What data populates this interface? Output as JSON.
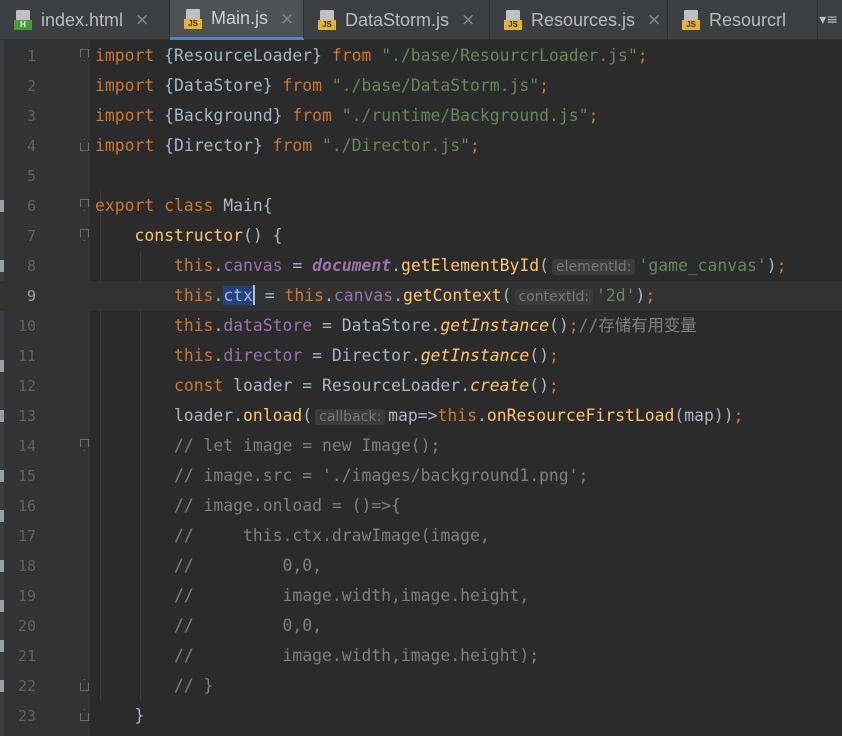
{
  "tabs": [
    {
      "label": "index.html",
      "type": "html",
      "active": false,
      "close": "×"
    },
    {
      "label": "Main.js",
      "type": "js",
      "active": true,
      "close": "×"
    },
    {
      "label": "DataStorm.js",
      "type": "js",
      "active": false,
      "close": "×"
    },
    {
      "label": "Resources.js",
      "type": "js",
      "active": false,
      "close": "×"
    },
    {
      "label": "Resourcrl",
      "type": "js",
      "active": false,
      "close": ""
    }
  ],
  "tab_overflow": "▾≡",
  "file_badges": {
    "html": "H",
    "js": "JS"
  },
  "caret_line": 9,
  "colors": {
    "background": "#2b2b2b",
    "gutter": "#313335",
    "keyword": "#cc7832",
    "string": "#6a8759",
    "property": "#9876aa",
    "method": "#ffc66d",
    "comment": "#808080",
    "default": "#a9b7c6",
    "selection": "#214283",
    "active_tab_underline": "#4a88c7"
  },
  "lines": [
    {
      "n": "1",
      "fold": "start",
      "tokens": [
        [
          "keyword",
          "import"
        ],
        [
          "plain",
          " {ResourceLoader} "
        ],
        [
          "keyword",
          "from"
        ],
        [
          "plain",
          " "
        ],
        [
          "string",
          "\"./base/ResourcrLoader.js\""
        ],
        [
          "keyword",
          ";"
        ]
      ]
    },
    {
      "n": "2",
      "tokens": [
        [
          "keyword",
          "import"
        ],
        [
          "plain",
          " {DataStore} "
        ],
        [
          "keyword",
          "from"
        ],
        [
          "plain",
          " "
        ],
        [
          "string",
          "\"./base/DataStorm.js\""
        ],
        [
          "keyword",
          ";"
        ]
      ]
    },
    {
      "n": "3",
      "tokens": [
        [
          "keyword",
          "import"
        ],
        [
          "plain",
          " {Background} "
        ],
        [
          "keyword",
          "from"
        ],
        [
          "plain",
          " "
        ],
        [
          "string",
          "\"./runtime/Background.js\""
        ],
        [
          "keyword",
          ";"
        ]
      ]
    },
    {
      "n": "4",
      "fold": "end",
      "tokens": [
        [
          "keyword",
          "import"
        ],
        [
          "plain",
          " {Director} "
        ],
        [
          "keyword",
          "from"
        ],
        [
          "plain",
          " "
        ],
        [
          "string",
          "\"./Director.js\""
        ],
        [
          "keyword",
          ";"
        ]
      ]
    },
    {
      "n": "5",
      "tokens": []
    },
    {
      "n": "6",
      "fold": "start",
      "tokens": [
        [
          "keyword",
          "export class "
        ],
        [
          "plain",
          "Main{"
        ]
      ]
    },
    {
      "n": "7",
      "fold": "start",
      "tokens": [
        [
          "plain",
          "    "
        ],
        [
          "method",
          "constructor"
        ],
        [
          "plain",
          "() {"
        ]
      ]
    },
    {
      "n": "8",
      "tokens": [
        [
          "plain",
          "        "
        ],
        [
          "this",
          "this"
        ],
        [
          "plain",
          "."
        ],
        [
          "prop",
          "canvas"
        ],
        [
          "plain",
          " = "
        ],
        [
          "global",
          "document"
        ],
        [
          "plain",
          "."
        ],
        [
          "method",
          "getElementById"
        ],
        [
          "plain",
          "("
        ],
        [
          "hint",
          "elementId:"
        ],
        [
          "string",
          "'game_canvas'"
        ],
        [
          "plain",
          ")"
        ],
        [
          "keyword",
          ";"
        ]
      ]
    },
    {
      "n": "9",
      "tokens": [
        [
          "plain",
          "        "
        ],
        [
          "this",
          "this"
        ],
        [
          "plain",
          "."
        ],
        [
          "selected",
          "ctx"
        ],
        [
          "caret",
          ""
        ],
        [
          "plain",
          " = "
        ],
        [
          "this",
          "this"
        ],
        [
          "plain",
          "."
        ],
        [
          "prop",
          "canvas"
        ],
        [
          "plain",
          "."
        ],
        [
          "method",
          "getContext"
        ],
        [
          "plain",
          "("
        ],
        [
          "hint",
          "contextId:"
        ],
        [
          "string",
          "'2d'"
        ],
        [
          "plain",
          ")"
        ],
        [
          "keyword",
          ";"
        ]
      ]
    },
    {
      "n": "10",
      "tokens": [
        [
          "plain",
          "        "
        ],
        [
          "this",
          "this"
        ],
        [
          "plain",
          "."
        ],
        [
          "prop",
          "dataStore"
        ],
        [
          "plain",
          " = DataStore."
        ],
        [
          "static",
          "getInstance"
        ],
        [
          "plain",
          "()"
        ],
        [
          "keyword",
          ";"
        ],
        [
          "comment",
          "//存储有用变量"
        ]
      ]
    },
    {
      "n": "11",
      "tokens": [
        [
          "plain",
          "        "
        ],
        [
          "this",
          "this"
        ],
        [
          "plain",
          "."
        ],
        [
          "prop",
          "director"
        ],
        [
          "plain",
          " = Director."
        ],
        [
          "static",
          "getInstance"
        ],
        [
          "plain",
          "()"
        ],
        [
          "keyword",
          ";"
        ]
      ]
    },
    {
      "n": "12",
      "tokens": [
        [
          "plain",
          "        "
        ],
        [
          "keyword",
          "const"
        ],
        [
          "plain",
          " loader = ResourceLoader."
        ],
        [
          "static",
          "create"
        ],
        [
          "plain",
          "()"
        ],
        [
          "keyword",
          ";"
        ]
      ]
    },
    {
      "n": "13",
      "tokens": [
        [
          "plain",
          "        loader."
        ],
        [
          "method",
          "onload"
        ],
        [
          "plain",
          "("
        ],
        [
          "hint",
          "callback:"
        ],
        [
          "plain",
          "map=>"
        ],
        [
          "this",
          "this"
        ],
        [
          "plain",
          "."
        ],
        [
          "method",
          "onResourceFirstLoad"
        ],
        [
          "plain",
          "(map))"
        ],
        [
          "keyword",
          ";"
        ]
      ]
    },
    {
      "n": "14",
      "fold": "start",
      "tokens": [
        [
          "plain",
          "        "
        ],
        [
          "comment",
          "// let image = new Image();"
        ]
      ]
    },
    {
      "n": "15",
      "tokens": [
        [
          "plain",
          "        "
        ],
        [
          "comment",
          "// image.src = './images/background1.png';"
        ]
      ]
    },
    {
      "n": "16",
      "tokens": [
        [
          "plain",
          "        "
        ],
        [
          "comment",
          "// image.onload = ()=>{"
        ]
      ]
    },
    {
      "n": "17",
      "tokens": [
        [
          "plain",
          "        "
        ],
        [
          "comment",
          "//     this.ctx.drawImage(image,"
        ]
      ]
    },
    {
      "n": "18",
      "tokens": [
        [
          "plain",
          "        "
        ],
        [
          "comment",
          "//         0,0,"
        ]
      ]
    },
    {
      "n": "19",
      "tokens": [
        [
          "plain",
          "        "
        ],
        [
          "comment",
          "//         image.width,image.height,"
        ]
      ]
    },
    {
      "n": "20",
      "tokens": [
        [
          "plain",
          "        "
        ],
        [
          "comment",
          "//         0,0,"
        ]
      ]
    },
    {
      "n": "21",
      "tokens": [
        [
          "plain",
          "        "
        ],
        [
          "comment",
          "//         image.width,image.height);"
        ]
      ]
    },
    {
      "n": "22",
      "fold": "end",
      "tokens": [
        [
          "plain",
          "        "
        ],
        [
          "comment",
          "// }"
        ]
      ]
    },
    {
      "n": "23",
      "fold": "end",
      "tokens": [
        [
          "plain",
          "    }"
        ]
      ]
    }
  ]
}
